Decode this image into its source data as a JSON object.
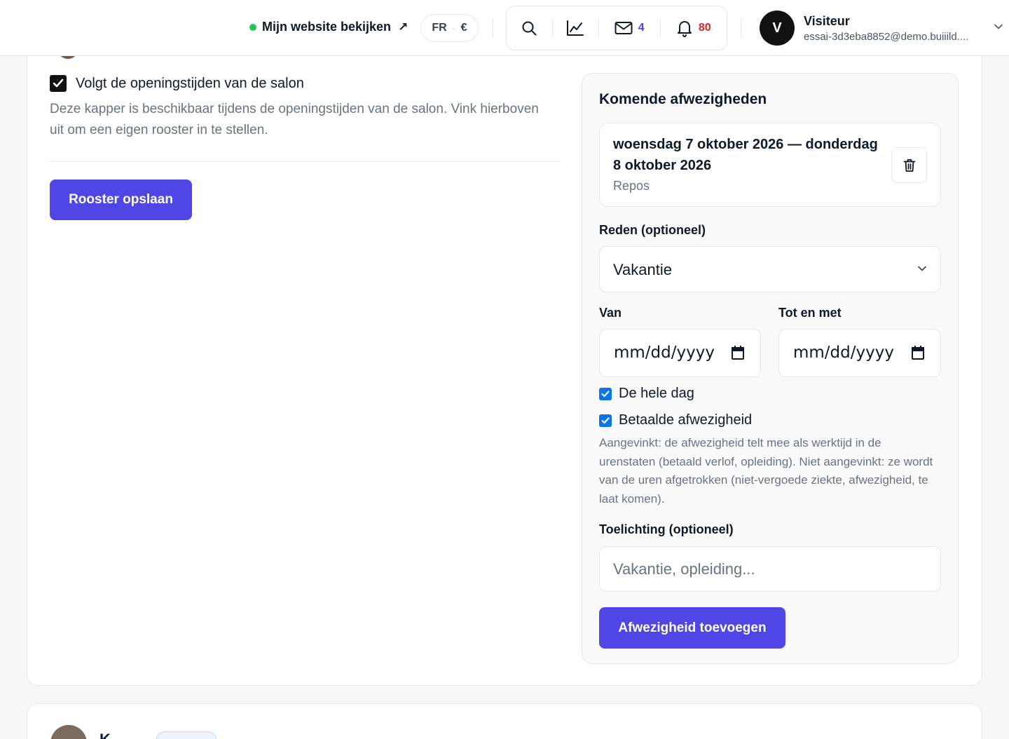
{
  "header": {
    "site_link_label": "Mijn website bekijken",
    "site_link_arrow": "↗",
    "locale": "FR",
    "currency": "€",
    "messages_count": "4",
    "notifications_count": "80",
    "user": {
      "initial": "V",
      "name": "Visiteur",
      "email": "essai-3d3eba8852@demo.buiiild...."
    }
  },
  "schedule": {
    "follow_hours_label": "Volgt de openingstijden van de salon",
    "follow_hours_checked": true,
    "follow_hours_help": "Deze kapper is beschikbaar tijdens de openingstijden van de salon. Vink hierboven uit om een eigen rooster in te stellen.",
    "save_button": "Rooster opslaan"
  },
  "absences": {
    "title": "Komende afwezigheden",
    "upcoming": [
      {
        "range": "woensdag 7 oktober 2026 — donderdag 8 oktober 2026",
        "reason": "Repos"
      }
    ],
    "form": {
      "reason_label": "Reden (optioneel)",
      "reason_value": "Vakantie",
      "from_label": "Van",
      "to_label": "Tot en met",
      "date_placeholder": "mm/dd/yyyy",
      "all_day_label": "De hele dag",
      "all_day_checked": true,
      "paid_label": "Betaalde afwezigheid",
      "paid_checked": true,
      "paid_help": "Aangevinkt: de afwezigheid telt mee als werktijd in de urenstaten (betaald verlof, opleiding). Niet aangevinkt: ze wordt van de uren afgetrokken (niet-vergoede ziekte, afwezigheid, te laat komen).",
      "note_label": "Toelichting (optioneel)",
      "note_placeholder": "Vakantie, opleiding...",
      "submit_button": "Afwezigheid toevoegen"
    }
  },
  "next_staff": {
    "name": "K..."
  },
  "colors": {
    "primary": "#4f46e5",
    "online_dot": "#22c55e",
    "notification_badge": "#dc2626",
    "checkbox_blue": "#0b74e6"
  },
  "icons": {
    "search": "search-icon",
    "stats": "chart-line-icon",
    "messages": "mail-icon",
    "notifications": "bell-icon",
    "delete": "trash-icon",
    "calendar": "calendar-icon"
  }
}
